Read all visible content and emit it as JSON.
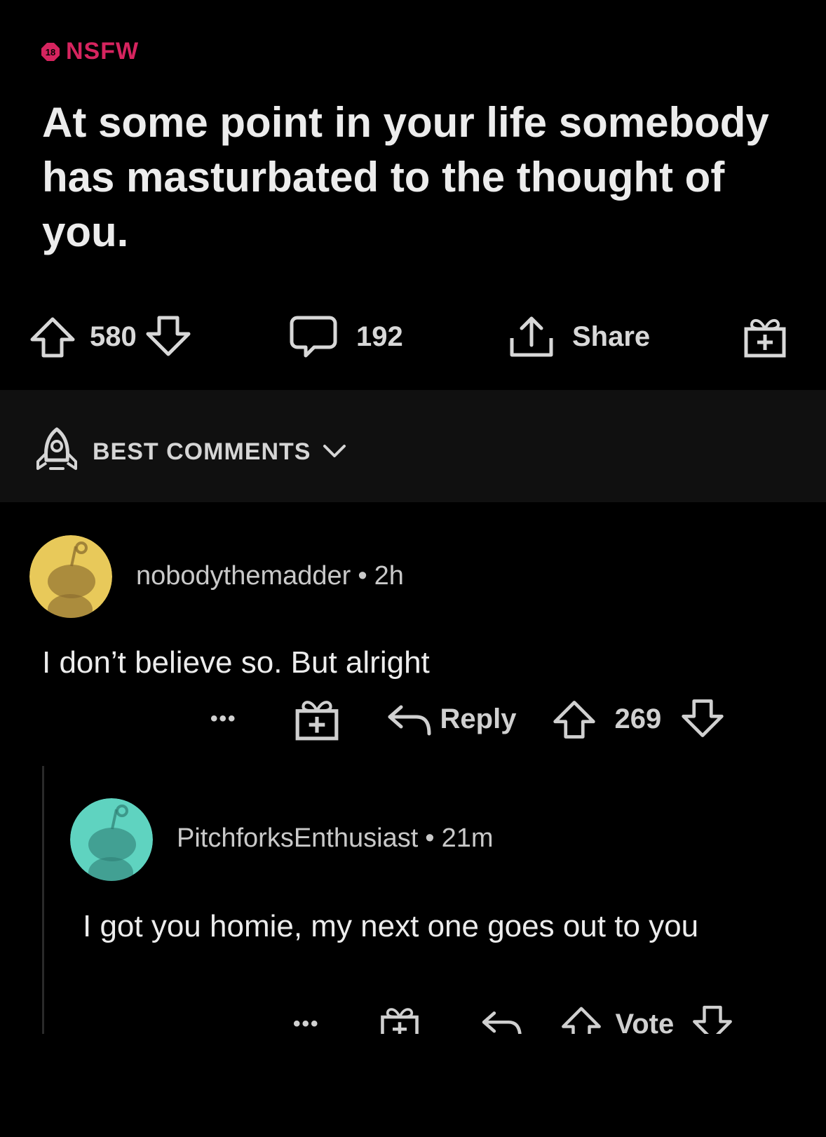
{
  "post": {
    "nsfw_label": "NSFW",
    "nsfw_badge": "18",
    "title": "At some point in your life somebody has masturbated to the thought of you.",
    "upvotes": "580",
    "comments": "192",
    "share_label": "Share"
  },
  "sort": {
    "label": "BEST COMMENTS"
  },
  "comments": [
    {
      "author": "nobodythemadder",
      "separator": "•",
      "age": "2h",
      "body": "I don’t believe so. But alright",
      "more_label": "•••",
      "reply_label": "Reply",
      "score": "269",
      "avatar_color": "#e8c95a"
    },
    {
      "author": "PitchforksEnthusiast",
      "separator": "•",
      "age": "21m",
      "body": "I got you homie, my next one goes out to you",
      "more_label": "•••",
      "vote_label": "Vote",
      "avatar_color": "#5fd3c0"
    }
  ],
  "colors": {
    "nsfw": "#d6245f",
    "background": "#000000",
    "sortbar": "#101010"
  }
}
